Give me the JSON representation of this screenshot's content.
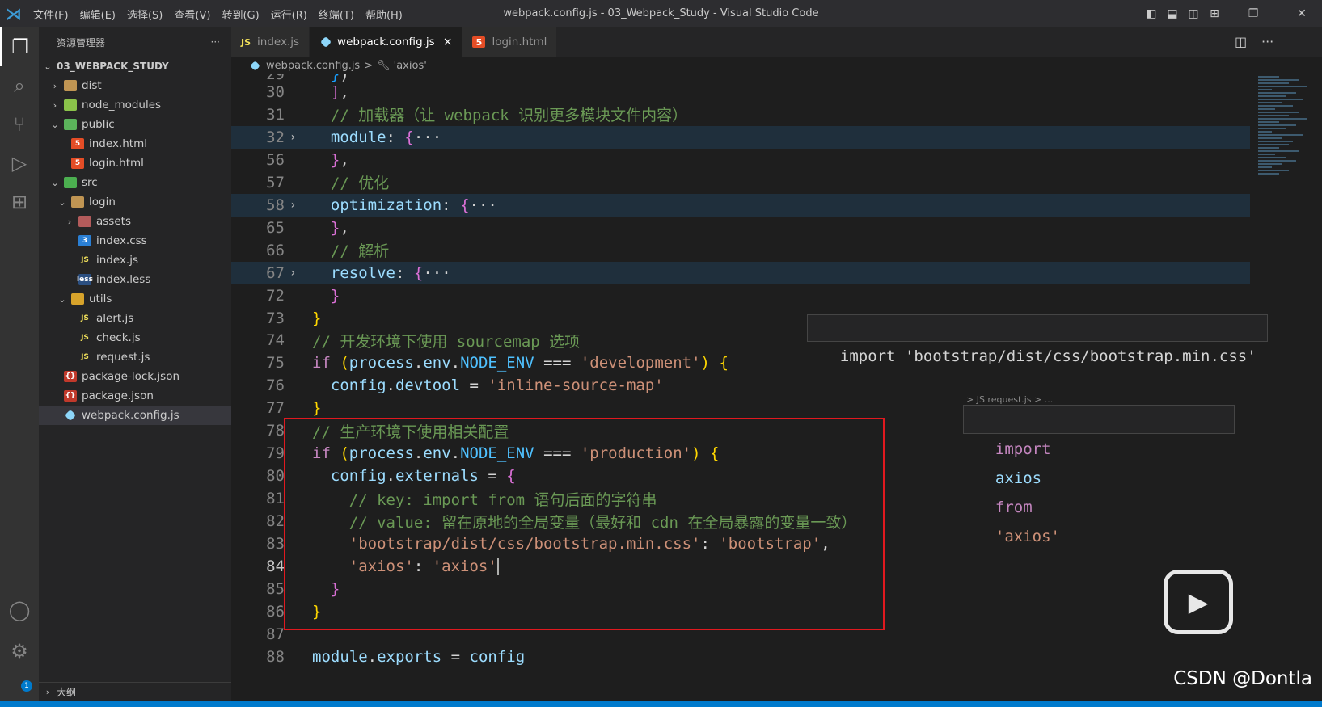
{
  "window": {
    "title": "webpack.config.js - 03_Webpack_Study - Visual Studio Code",
    "menu": [
      "文件(F)",
      "编辑(E)",
      "选择(S)",
      "查看(V)",
      "转到(G)",
      "运行(R)",
      "终端(T)",
      "帮助(H)"
    ]
  },
  "sidebar": {
    "title": "资源管理器",
    "more": "···",
    "root": "03_WEBPACK_STUDY",
    "tree": [
      {
        "label": "dist",
        "depth": 1,
        "kind": "folder",
        "twisty": "›"
      },
      {
        "label": "node_modules",
        "depth": 1,
        "kind": "nm",
        "twisty": "›"
      },
      {
        "label": "public",
        "depth": 1,
        "kind": "pub",
        "twisty": "⌄"
      },
      {
        "label": "index.html",
        "depth": 2,
        "kind": "html",
        "twisty": ""
      },
      {
        "label": "login.html",
        "depth": 2,
        "kind": "html",
        "twisty": ""
      },
      {
        "label": "src",
        "depth": 1,
        "kind": "srcf",
        "twisty": "⌄"
      },
      {
        "label": "login",
        "depth": 2,
        "kind": "folder",
        "twisty": "⌄"
      },
      {
        "label": "assets",
        "depth": 3,
        "kind": "ast",
        "twisty": "›"
      },
      {
        "label": "index.css",
        "depth": 3,
        "kind": "css",
        "twisty": ""
      },
      {
        "label": "index.js",
        "depth": 3,
        "kind": "js",
        "twisty": ""
      },
      {
        "label": "index.less",
        "depth": 3,
        "kind": "less",
        "twisty": ""
      },
      {
        "label": "utils",
        "depth": 2,
        "kind": "utl",
        "twisty": "⌄"
      },
      {
        "label": "alert.js",
        "depth": 3,
        "kind": "js",
        "twisty": ""
      },
      {
        "label": "check.js",
        "depth": 3,
        "kind": "js",
        "twisty": ""
      },
      {
        "label": "request.js",
        "depth": 3,
        "kind": "js",
        "twisty": ""
      },
      {
        "label": "package-lock.json",
        "depth": 1,
        "kind": "json",
        "twisty": ""
      },
      {
        "label": "package.json",
        "depth": 1,
        "kind": "json",
        "twisty": ""
      },
      {
        "label": "webpack.config.js",
        "depth": 1,
        "kind": "wp",
        "twisty": "",
        "selected": true
      }
    ],
    "outline": "大纲"
  },
  "tabs": [
    {
      "label": "index.js",
      "icon": "JS",
      "active": false
    },
    {
      "label": "webpack.config.js",
      "icon": "wp",
      "active": true,
      "close": "×"
    },
    {
      "label": "login.html",
      "icon": "html",
      "active": false
    }
  ],
  "breadcrumb": {
    "file": "webpack.config.js",
    "sep": ">",
    "symbol": "'axios'"
  },
  "code_lines": [
    {
      "n": "29",
      "tokens": [
        [
          "pn",
          "  "
        ],
        [
          "br3",
          "}"
        ],
        [
          "pn",
          ")"
        ]
      ],
      "partial": true
    },
    {
      "n": "30",
      "tokens": [
        [
          "pn",
          "  "
        ],
        [
          "br2",
          "]"
        ],
        [
          "pn",
          ","
        ]
      ]
    },
    {
      "n": "31",
      "tokens": [
        [
          "pn",
          "  "
        ],
        [
          "cm",
          "// 加载器（让 webpack 识别更多模块文件内容）"
        ]
      ]
    },
    {
      "n": "32",
      "fold": true,
      "hl": true,
      "tokens": [
        [
          "pn",
          "  "
        ],
        [
          "vr",
          "module"
        ],
        [
          "pn",
          ": "
        ],
        [
          "br2",
          "{"
        ],
        [
          "pn",
          "···"
        ]
      ]
    },
    {
      "n": "56",
      "tokens": [
        [
          "pn",
          "  "
        ],
        [
          "br2",
          "}"
        ],
        [
          "pn",
          ","
        ]
      ]
    },
    {
      "n": "57",
      "tokens": [
        [
          "pn",
          "  "
        ],
        [
          "cm",
          "// 优化"
        ]
      ]
    },
    {
      "n": "58",
      "fold": true,
      "hl": true,
      "tokens": [
        [
          "pn",
          "  "
        ],
        [
          "vr",
          "optimization"
        ],
        [
          "pn",
          ": "
        ],
        [
          "br2",
          "{"
        ],
        [
          "pn",
          "···"
        ]
      ]
    },
    {
      "n": "65",
      "tokens": [
        [
          "pn",
          "  "
        ],
        [
          "br2",
          "}"
        ],
        [
          "pn",
          ","
        ]
      ]
    },
    {
      "n": "66",
      "tokens": [
        [
          "pn",
          "  "
        ],
        [
          "cm",
          "// 解析"
        ]
      ]
    },
    {
      "n": "67",
      "fold": true,
      "hl": true,
      "tokens": [
        [
          "pn",
          "  "
        ],
        [
          "vr",
          "resolve"
        ],
        [
          "pn",
          ": "
        ],
        [
          "br2",
          "{"
        ],
        [
          "pn",
          "···"
        ]
      ]
    },
    {
      "n": "72",
      "tokens": [
        [
          "pn",
          "  "
        ],
        [
          "br2",
          "}"
        ]
      ]
    },
    {
      "n": "73",
      "tokens": [
        [
          "br1",
          "}"
        ]
      ]
    },
    {
      "n": "74",
      "tokens": [
        [
          "cm",
          "// 开发环境下使用 sourcemap 选项"
        ]
      ]
    },
    {
      "n": "75",
      "tokens": [
        [
          "kw",
          "if"
        ],
        [
          "pn",
          " "
        ],
        [
          "br1",
          "("
        ],
        [
          "vr",
          "process"
        ],
        [
          "pn",
          "."
        ],
        [
          "vr",
          "env"
        ],
        [
          "pn",
          "."
        ],
        [
          "cn",
          "NODE_ENV"
        ],
        [
          "pn",
          " === "
        ],
        [
          "str",
          "'development'"
        ],
        [
          "br1",
          ")"
        ],
        [
          "pn",
          " "
        ],
        [
          "br1",
          "{"
        ]
      ]
    },
    {
      "n": "76",
      "tokens": [
        [
          "pn",
          "  "
        ],
        [
          "vr",
          "config"
        ],
        [
          "pn",
          "."
        ],
        [
          "vr",
          "devtool"
        ],
        [
          "pn",
          " = "
        ],
        [
          "str",
          "'inline-source-map'"
        ]
      ]
    },
    {
      "n": "77",
      "tokens": [
        [
          "br1",
          "}"
        ]
      ]
    },
    {
      "n": "78",
      "tokens": [
        [
          "cm",
          "// 生产环境下使用相关配置"
        ]
      ]
    },
    {
      "n": "79",
      "tokens": [
        [
          "kw",
          "if"
        ],
        [
          "pn",
          " "
        ],
        [
          "br1",
          "("
        ],
        [
          "vr",
          "process"
        ],
        [
          "pn",
          "."
        ],
        [
          "vr",
          "env"
        ],
        [
          "pn",
          "."
        ],
        [
          "cn",
          "NODE_ENV"
        ],
        [
          "pn",
          " === "
        ],
        [
          "str",
          "'production'"
        ],
        [
          "br1",
          ")"
        ],
        [
          "pn",
          " "
        ],
        [
          "br1",
          "{"
        ]
      ]
    },
    {
      "n": "80",
      "tokens": [
        [
          "pn",
          "  "
        ],
        [
          "vr",
          "config"
        ],
        [
          "pn",
          "."
        ],
        [
          "vr",
          "externals"
        ],
        [
          "pn",
          " = "
        ],
        [
          "br2",
          "{"
        ]
      ]
    },
    {
      "n": "81",
      "tokens": [
        [
          "pn",
          "    "
        ],
        [
          "cm",
          "// key: import from 语句后面的字符串"
        ]
      ]
    },
    {
      "n": "82",
      "tokens": [
        [
          "pn",
          "    "
        ],
        [
          "cm",
          "// value: 留在原地的全局变量（最好和 cdn 在全局暴露的变量一致）"
        ]
      ]
    },
    {
      "n": "83",
      "tokens": [
        [
          "pn",
          "    "
        ],
        [
          "str",
          "'bootstrap/dist/css/bootstrap.min.css'"
        ],
        [
          "pn",
          ": "
        ],
        [
          "str",
          "'bootstrap'"
        ],
        [
          "pn",
          ","
        ]
      ]
    },
    {
      "n": "84",
      "cur": true,
      "tokens": [
        [
          "pn",
          "    "
        ],
        [
          "str",
          "'axios'"
        ],
        [
          "pn",
          ": "
        ],
        [
          "str",
          "'axios'"
        ]
      ]
    },
    {
      "n": "85",
      "tokens": [
        [
          "pn",
          "  "
        ],
        [
          "br2",
          "}"
        ]
      ]
    },
    {
      "n": "86",
      "tokens": [
        [
          "br1",
          "}"
        ]
      ]
    },
    {
      "n": "87",
      "tokens": []
    },
    {
      "n": "88",
      "tokens": [
        [
          "vr",
          "module"
        ],
        [
          "pn",
          "."
        ],
        [
          "vr",
          "exports"
        ],
        [
          "pn",
          " = "
        ],
        [
          "vr",
          "config"
        ]
      ]
    }
  ],
  "hover1": {
    "text": "import 'bootstrap/dist/css/bootstrap.min.css'"
  },
  "hover2": {
    "crumb": "> JS request.js > ...",
    "kw_import": "import",
    "ident": "axios",
    "kw_from": "from",
    "str": "'axios'"
  },
  "watermark": "CSDN @Dontla",
  "badge": "1"
}
